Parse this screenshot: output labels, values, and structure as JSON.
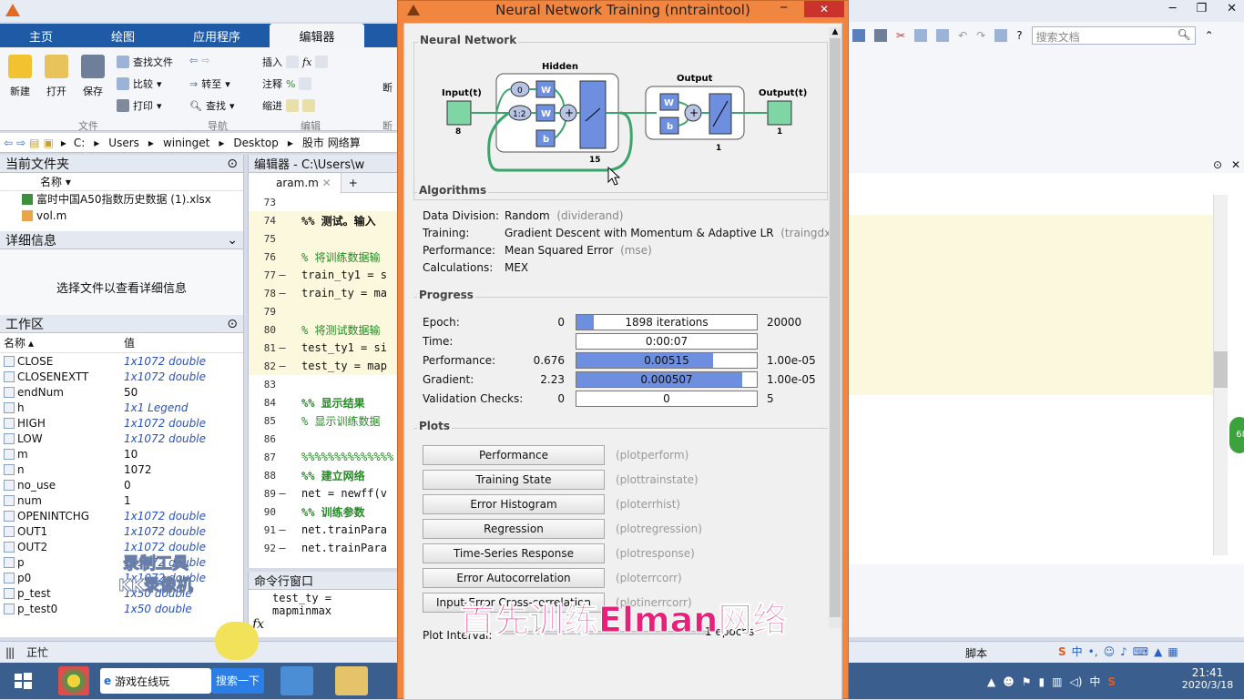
{
  "matlab": {
    "ribbon_tabs": [
      "主页",
      "绘图",
      "应用程序",
      "编辑器"
    ],
    "file_buttons": {
      "new": "新建",
      "open": "打开",
      "save": "保存"
    },
    "file_small": {
      "find_files": "查找文件",
      "compare": "比较",
      "print": "打印"
    },
    "nav_small": {
      "goto": "转至",
      "find": "查找"
    },
    "edit_small": {
      "insert": "插入",
      "comment": "注释",
      "indent": "缩进"
    },
    "break_label": "断",
    "groups": {
      "file": "文件",
      "nav": "导航",
      "edit": "编辑",
      "break": "断"
    },
    "search_docs_placeholder": "搜索文档",
    "path": [
      "C:",
      "Users",
      "wininget",
      "Desktop",
      "股市 网络算"
    ],
    "current_folder": {
      "title": "当前文件夹",
      "col_name": "名称",
      "files": [
        "富时中国A50指数历史数据 (1).xlsx",
        "vol.m"
      ]
    },
    "details": {
      "title": "详细信息",
      "hint": "选择文件以查看详细信息"
    },
    "workspace": {
      "title": "工作区",
      "col_name": "名称",
      "col_value": "值",
      "rows": [
        {
          "name": "CLOSE",
          "value": "1x1072 double",
          "italic": true
        },
        {
          "name": "CLOSENEXTT",
          "value": "1x1072 double",
          "italic": true
        },
        {
          "name": "endNum",
          "value": "50",
          "italic": false
        },
        {
          "name": "h",
          "value": "1x1 Legend",
          "italic": true
        },
        {
          "name": "HIGH",
          "value": "1x1072 double",
          "italic": true
        },
        {
          "name": "LOW",
          "value": "1x1072 double",
          "italic": true
        },
        {
          "name": "m",
          "value": "10",
          "italic": false
        },
        {
          "name": "n",
          "value": "1072",
          "italic": false
        },
        {
          "name": "no_use",
          "value": "0",
          "italic": false
        },
        {
          "name": "num",
          "value": "1",
          "italic": false
        },
        {
          "name": "OPENINTCHG",
          "value": "1x1072 double",
          "italic": true
        },
        {
          "name": "OUT1",
          "value": "1x1072 double",
          "italic": true
        },
        {
          "name": "OUT2",
          "value": "1x1072 double",
          "italic": true
        },
        {
          "name": "p",
          "value": "1x1072 double",
          "italic": true
        },
        {
          "name": "p0",
          "value": "1x1072 double",
          "italic": true
        },
        {
          "name": "p_test",
          "value": "1x50 double",
          "italic": true
        },
        {
          "name": "p_test0",
          "value": "1x50 double",
          "italic": true
        }
      ]
    },
    "editor": {
      "title": "编辑器 - C:\\Users\\w",
      "tab": "aram.m",
      "lines": [
        {
          "n": "73",
          "dash": "",
          "code": "",
          "cell": false,
          "cls": ""
        },
        {
          "n": "74",
          "dash": "",
          "code": "%% 测试。输入",
          "cell": true,
          "cls": "bold"
        },
        {
          "n": "75",
          "dash": "",
          "code": "",
          "cell": true,
          "cls": ""
        },
        {
          "n": "76",
          "dash": "",
          "code": "% 将训练数据输",
          "cell": true,
          "cls": "cm"
        },
        {
          "n": "77",
          "dash": "–",
          "code": "train_ty1 = s",
          "cell": true,
          "cls": ""
        },
        {
          "n": "78",
          "dash": "–",
          "code": "train_ty = ma",
          "cell": true,
          "cls": ""
        },
        {
          "n": "79",
          "dash": "",
          "code": "",
          "cell": true,
          "cls": ""
        },
        {
          "n": "80",
          "dash": "",
          "code": "% 将测试数据输",
          "cell": true,
          "cls": "cm"
        },
        {
          "n": "81",
          "dash": "–",
          "code": "test_ty1 = si",
          "cell": true,
          "cls": ""
        },
        {
          "n": "82",
          "dash": "–",
          "code": "test_ty = map",
          "cell": true,
          "cls": ""
        },
        {
          "n": "83",
          "dash": "",
          "code": "",
          "cell": false,
          "cls": ""
        },
        {
          "n": "84",
          "dash": "",
          "code": "%% 显示结果",
          "cell": false,
          "cls": "cmb"
        },
        {
          "n": "85",
          "dash": "",
          "code": "% 显示训练数据",
          "cell": false,
          "cls": "cm"
        },
        {
          "n": "86",
          "dash": "",
          "code": "",
          "cell": false,
          "cls": ""
        },
        {
          "n": "87",
          "dash": "",
          "code": "%%%%%%%%%%%%%%",
          "cell": false,
          "cls": "cm"
        },
        {
          "n": "88",
          "dash": "",
          "code": "%% 建立网络",
          "cell": false,
          "cls": "cmb"
        },
        {
          "n": "89",
          "dash": "–",
          "code": "net = newff(v",
          "cell": false,
          "cls": ""
        },
        {
          "n": "90",
          "dash": "",
          "code": "%% 训练参数",
          "cell": false,
          "cls": "cmb"
        },
        {
          "n": "91",
          "dash": "–",
          "code": "net.trainPara",
          "cell": false,
          "cls": ""
        },
        {
          "n": "92",
          "dash": "–",
          "code": "net.trainPara",
          "cell": false,
          "cls": ""
        }
      ]
    },
    "command_window": {
      "title": "命令行窗口",
      "line": "test_ty = mapminmax",
      "prompt": "fx"
    },
    "status": {
      "busy": "正忙",
      "script": "脚本"
    },
    "watermark": {
      "line1": "录制工具",
      "line2": "KK录像机"
    }
  },
  "nntraintool": {
    "title": "Neural Network Training (nntraintool)",
    "network": {
      "section": "Neural Network",
      "input_label": "Input(t)",
      "input_size": "8",
      "hidden_label": "Hidden",
      "hidden_size": "15",
      "delay0": "0",
      "delay12": "1:2",
      "output_label": "Output",
      "output_size": "1",
      "output_t_label": "Output(t)",
      "output_t_size": "1",
      "w": "W",
      "b": "b"
    },
    "algorithms": {
      "section": "Algorithms",
      "rows": [
        {
          "label": "Data Division:",
          "value": "Random",
          "fn": "(dividerand)"
        },
        {
          "label": "Training:",
          "value": "Gradient Descent with Momentum & Adaptive LR",
          "fn": "(traingdx)"
        },
        {
          "label": "Performance:",
          "value": "Mean Squared Error",
          "fn": "(mse)"
        },
        {
          "label": "Calculations:",
          "value": "MEX",
          "fn": ""
        }
      ]
    },
    "progress": {
      "section": "Progress",
      "rows": [
        {
          "label": "Epoch:",
          "start": "0",
          "value": "1898 iterations",
          "end": "20000",
          "fill": 0.095
        },
        {
          "label": "Time:",
          "start": "",
          "value": "0:00:07",
          "end": "",
          "fill": 0
        },
        {
          "label": "Performance:",
          "start": "0.676",
          "value": "0.00515",
          "end": "1.00e-05",
          "fill": 0.76
        },
        {
          "label": "Gradient:",
          "start": "2.23",
          "value": "0.000507",
          "end": "1.00e-05",
          "fill": 0.92
        },
        {
          "label": "Validation Checks:",
          "start": "0",
          "value": "0",
          "end": "5",
          "fill": 0
        }
      ]
    },
    "plots": {
      "section": "Plots",
      "buttons": [
        {
          "label": "Performance",
          "fn": "(plotperform)"
        },
        {
          "label": "Training State",
          "fn": "(plottrainstate)"
        },
        {
          "label": "Error Histogram",
          "fn": "(ploterrhist)"
        },
        {
          "label": "Regression",
          "fn": "(plotregression)"
        },
        {
          "label": "Time-Series Response",
          "fn": "(plotresponse)"
        },
        {
          "label": "Error Autocorrelation",
          "fn": "(ploterrcorr)"
        },
        {
          "label": "Input-Error Cross-correlation",
          "fn": "(plotinerrcorr)"
        }
      ],
      "interval_label": "Plot Interval:",
      "interval_value": "1 epochs"
    }
  },
  "subtitle": "首先训练Elman网络",
  "taskbar": {
    "game_text": "游戏在线玩",
    "search_btn": "搜索一下",
    "time": "21:41",
    "date": "2020/3/18",
    "ime": "中"
  }
}
